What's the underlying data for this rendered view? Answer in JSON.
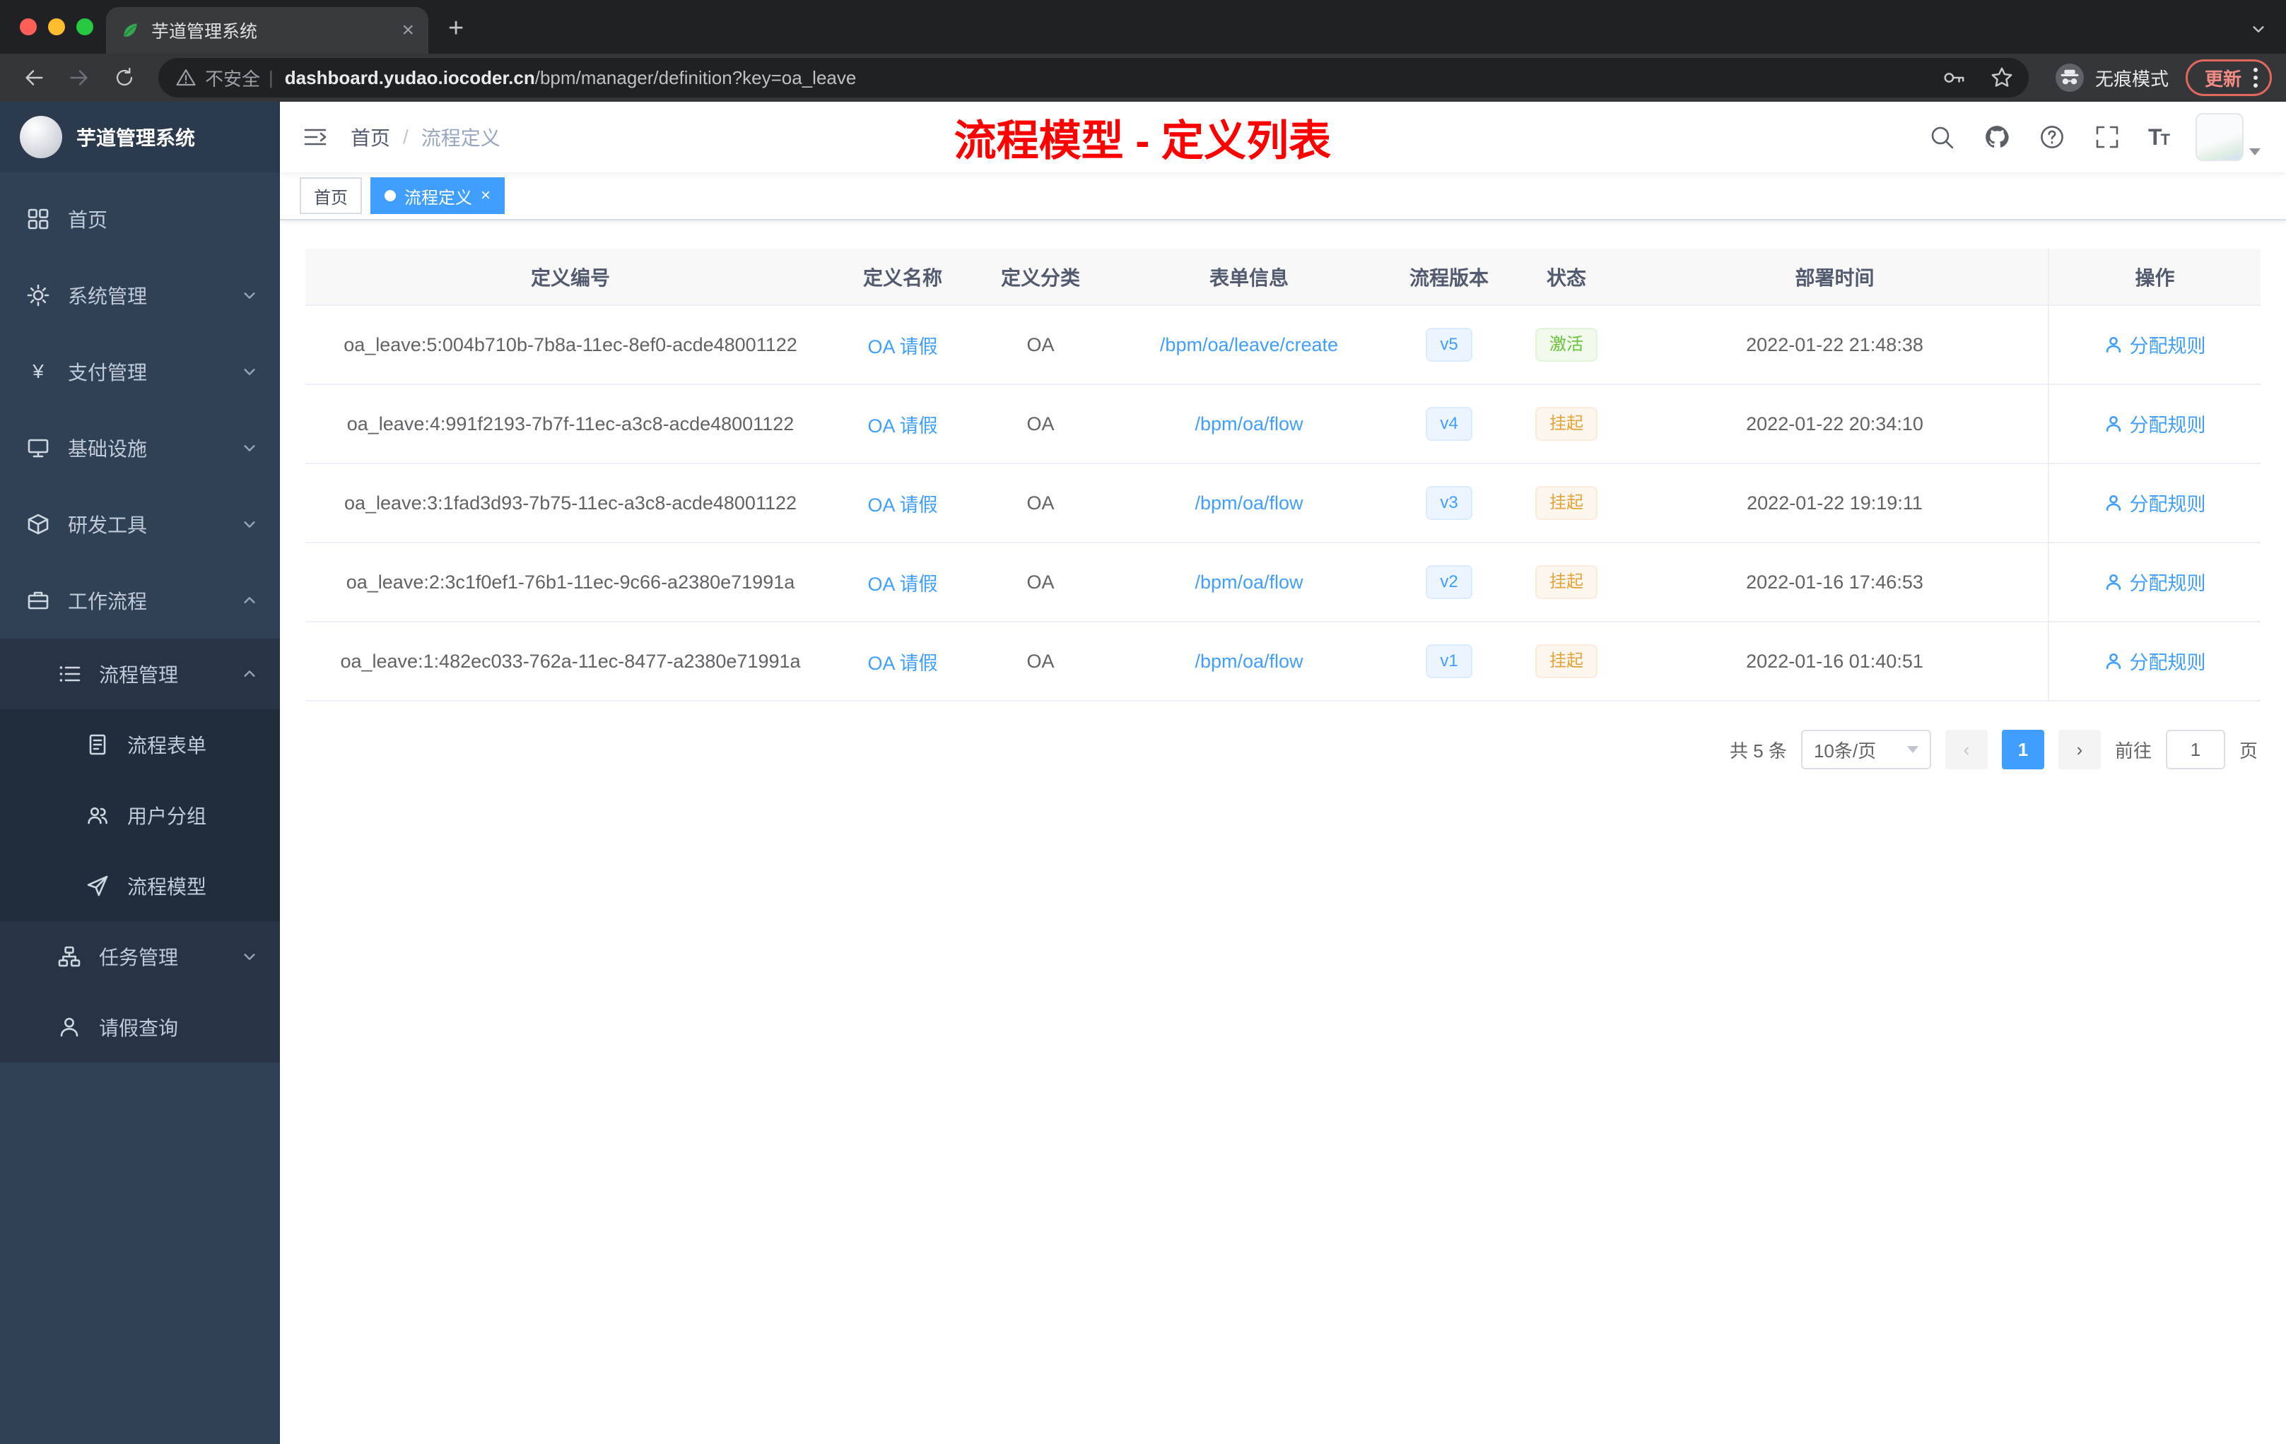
{
  "browser": {
    "tab_title": "芋道管理系统",
    "security_label": "不安全",
    "url_host": "dashboard.yudao.iocoder.cn",
    "url_path": "/bpm/manager/definition?key=oa_leave",
    "incognito_label": "无痕模式",
    "update_label": "更新"
  },
  "colors": {
    "accent_blue": "#409eff",
    "title_red": "#ff0000",
    "sidebar_bg": "#304156",
    "tag_success_text": "#67c23a",
    "tag_warning_text": "#e6a23c"
  },
  "sidebar": {
    "logo_title": "芋道管理系统",
    "items": [
      {
        "label": "首页",
        "icon": "dashboard-icon"
      },
      {
        "label": "系统管理",
        "icon": "gear-icon",
        "chevron": "down"
      },
      {
        "label": "支付管理",
        "icon": "yen-icon",
        "chevron": "down"
      },
      {
        "label": "基础设施",
        "icon": "monitor-icon",
        "chevron": "down"
      },
      {
        "label": "研发工具",
        "icon": "cube-icon",
        "chevron": "down"
      },
      {
        "label": "工作流程",
        "icon": "briefcase-icon",
        "chevron": "up"
      },
      {
        "label": "流程管理",
        "icon": "list-icon",
        "chevron": "up"
      },
      {
        "label": "流程表单",
        "icon": "form-icon"
      },
      {
        "label": "用户分组",
        "icon": "users-icon"
      },
      {
        "label": "流程模型",
        "icon": "paper-plane-icon"
      },
      {
        "label": "任务管理",
        "icon": "tree-icon",
        "chevron": "down"
      },
      {
        "label": "请假查询",
        "icon": "user-icon"
      }
    ]
  },
  "navbar": {
    "breadcrumb_home": "首页",
    "breadcrumb_separator": "/",
    "breadcrumb_current": "流程定义",
    "red_title": "流程模型 - 定义列表",
    "icons": [
      "search-icon",
      "github-icon",
      "question-icon",
      "fullscreen-icon",
      "font-size-icon",
      "avatar"
    ]
  },
  "tags": {
    "home": "首页",
    "active": "流程定义"
  },
  "table": {
    "columns": [
      "定义编号",
      "定义名称",
      "定义分类",
      "表单信息",
      "流程版本",
      "状态",
      "部署时间",
      "操作"
    ],
    "rows": [
      {
        "id": "oa_leave:5:004b710b-7b8a-11ec-8ef0-acde48001122",
        "name": "OA 请假",
        "category": "OA",
        "form": "/bpm/oa/leave/create",
        "version": "v5",
        "status": "激活",
        "status_type": "success",
        "time": "2022-01-22 21:48:38",
        "action": "分配规则"
      },
      {
        "id": "oa_leave:4:991f2193-7b7f-11ec-a3c8-acde48001122",
        "name": "OA 请假",
        "category": "OA",
        "form": "/bpm/oa/flow",
        "version": "v4",
        "status": "挂起",
        "status_type": "warning",
        "time": "2022-01-22 20:34:10",
        "action": "分配规则"
      },
      {
        "id": "oa_leave:3:1fad3d93-7b75-11ec-a3c8-acde48001122",
        "name": "OA 请假",
        "category": "OA",
        "form": "/bpm/oa/flow",
        "version": "v3",
        "status": "挂起",
        "status_type": "warning",
        "time": "2022-01-22 19:19:11",
        "action": "分配规则"
      },
      {
        "id": "oa_leave:2:3c1f0ef1-76b1-11ec-9c66-a2380e71991a",
        "name": "OA 请假",
        "category": "OA",
        "form": "/bpm/oa/flow",
        "version": "v2",
        "status": "挂起",
        "status_type": "warning",
        "time": "2022-01-16 17:46:53",
        "action": "分配规则"
      },
      {
        "id": "oa_leave:1:482ec033-762a-11ec-8477-a2380e71991a",
        "name": "OA 请假",
        "category": "OA",
        "form": "/bpm/oa/flow",
        "version": "v1",
        "status": "挂起",
        "status_type": "warning",
        "time": "2022-01-16 01:40:51",
        "action": "分配规则"
      }
    ]
  },
  "pagination": {
    "total": "共 5 条",
    "page_size": "10条/页",
    "current_page": "1",
    "goto_label": "前往",
    "goto_value": "1",
    "goto_unit": "页"
  }
}
